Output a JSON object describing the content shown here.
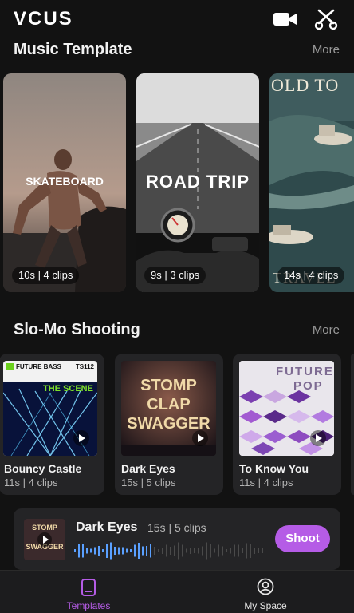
{
  "app": {
    "logo": "VCUS"
  },
  "header": {
    "video_icon": "video-camera-icon",
    "scissors_icon": "scissors-icon"
  },
  "music_section": {
    "title": "Music Template",
    "more": "More",
    "cards": [
      {
        "title": "SKATEBOARD",
        "meta": "10s | 4 clips"
      },
      {
        "title": "ROAD TRIP",
        "meta": "9s | 3 clips"
      },
      {
        "title": "OLD TO",
        "subtitle": "TRAVEL",
        "meta": "14s | 4 clips"
      }
    ]
  },
  "slomo_section": {
    "title": "Slo-Mo Shooting",
    "more": "More",
    "cards": [
      {
        "name": "Bouncy Castle",
        "meta": "11s | 4 clips",
        "cover_top_left": "FUTURE BASS",
        "cover_top_right": "TS112",
        "cover_mid": "THE SCENE"
      },
      {
        "name": "Dark Eyes",
        "meta": "15s | 5 clips",
        "cover_lines": [
          "STOMP",
          "CLAP",
          "SWAGGER"
        ]
      },
      {
        "name": "To Know You",
        "meta": "11s | 4 clips",
        "cover_lines": [
          "FUTURE",
          "POP"
        ]
      }
    ]
  },
  "player": {
    "title": "Dark Eyes",
    "meta": "15s | 5 clips",
    "button": "Shoot",
    "progress": 0.4,
    "cover_lines": [
      "STOMP",
      "CLAP",
      "SWAGGER"
    ]
  },
  "tabbar": {
    "items": [
      {
        "label": "Templates",
        "icon": "templates-icon",
        "active": true
      },
      {
        "label": "My Space",
        "icon": "profile-icon",
        "active": false
      }
    ]
  },
  "colors": {
    "accent": "#b55ce6",
    "background": "#121212",
    "card": "#242426"
  }
}
